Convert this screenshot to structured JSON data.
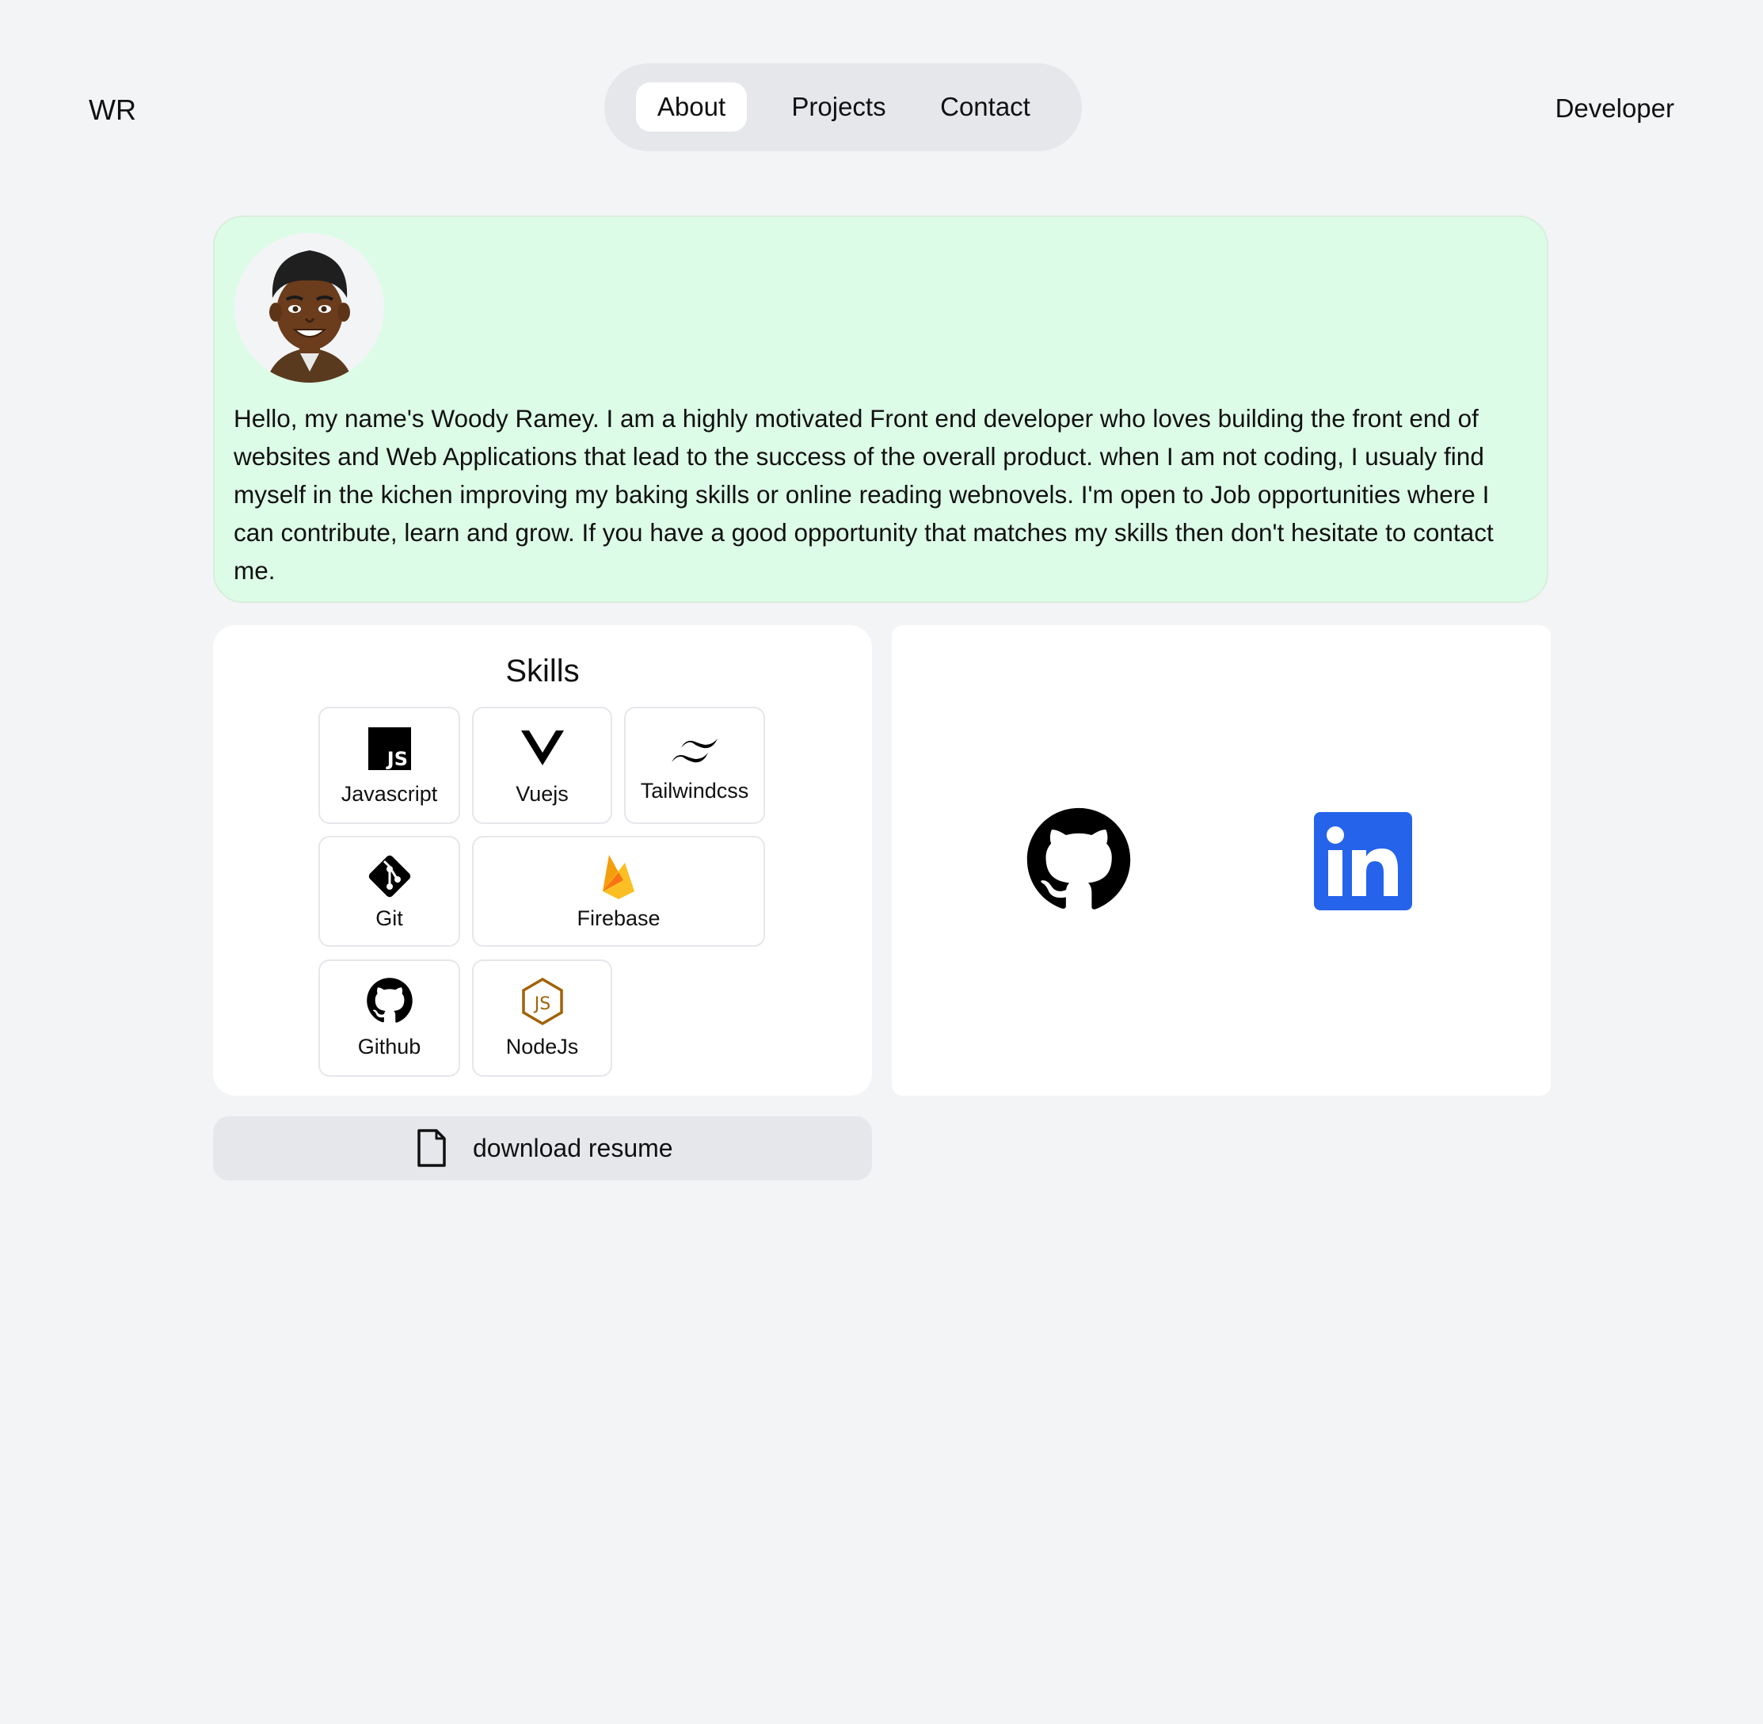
{
  "header": {
    "logo": "WR",
    "nav": [
      {
        "label": "About",
        "active": true
      },
      {
        "label": "Projects",
        "active": false
      },
      {
        "label": "Contact",
        "active": false
      }
    ],
    "role": "Developer"
  },
  "about": {
    "bio": "Hello, my name's Woody Ramey. I am a highly motivated Front end developer who loves building the front end of websites and Web Applications that lead to the success of the overall product. when I am not coding, I usualy find myself in the kichen improving my baking skills or online reading webnovels. I'm open to Job opportunities where I can contribute, learn and grow. If you have a good opportunity that matches my skills then don't hesitate to contact me.",
    "avatar_icon": "avatar-illustration",
    "card_color": "#dcfce7"
  },
  "skills": {
    "title": "Skills",
    "items": [
      {
        "label": "Javascript",
        "icon": "javascript-icon"
      },
      {
        "label": "Vuejs",
        "icon": "vuejs-icon"
      },
      {
        "label": "Tailwindcss",
        "icon": "tailwindcss-icon"
      },
      {
        "label": "Git",
        "icon": "git-icon"
      },
      {
        "label": "Firebase",
        "icon": "firebase-icon"
      },
      {
        "label": "Github",
        "icon": "github-icon"
      },
      {
        "label": "NodeJs",
        "icon": "nodejs-icon"
      }
    ]
  },
  "social": {
    "links": [
      {
        "icon": "github-icon"
      },
      {
        "icon": "linkedin-icon",
        "color": "#2563eb"
      }
    ]
  },
  "resume": {
    "label": "download resume",
    "icon": "file-icon"
  }
}
